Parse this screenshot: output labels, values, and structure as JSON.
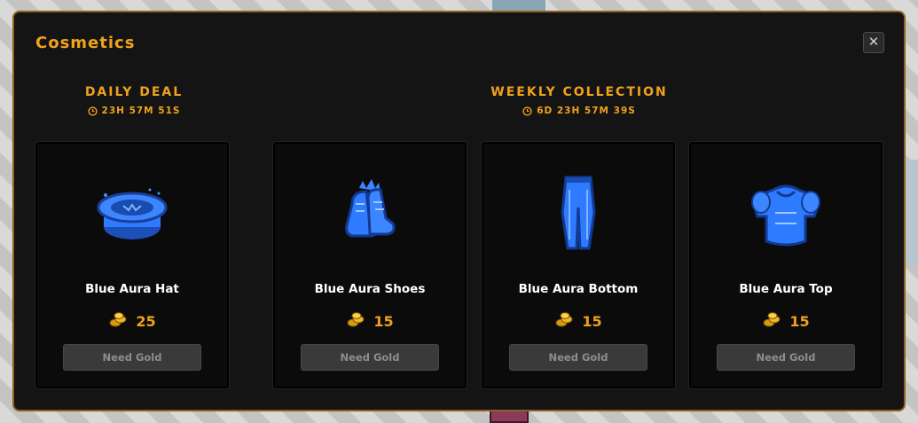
{
  "modal": {
    "title": "Cosmetics",
    "close_label": "✕"
  },
  "daily": {
    "title": "DAILY DEAL",
    "timer": "23H 57M 51S",
    "items": [
      {
        "name": "Blue Aura Hat",
        "price": "25",
        "button": "Need Gold",
        "icon": "hat-icon"
      }
    ]
  },
  "weekly": {
    "title": "WEEKLY COLLECTION",
    "timer": "6D 23H 57M 39S",
    "items": [
      {
        "name": "Blue Aura Shoes",
        "price": "15",
        "button": "Need Gold",
        "icon": "shoes-icon"
      },
      {
        "name": "Blue Aura Bottom",
        "price": "15",
        "button": "Need Gold",
        "icon": "pants-icon"
      },
      {
        "name": "Blue Aura Top",
        "price": "15",
        "button": "Need Gold",
        "icon": "armor-top-icon"
      }
    ]
  },
  "colors": {
    "accent": "#f0a21c",
    "panel": "#141414",
    "card": "#0b0b0b",
    "aura_blue": "#2f7bff"
  }
}
